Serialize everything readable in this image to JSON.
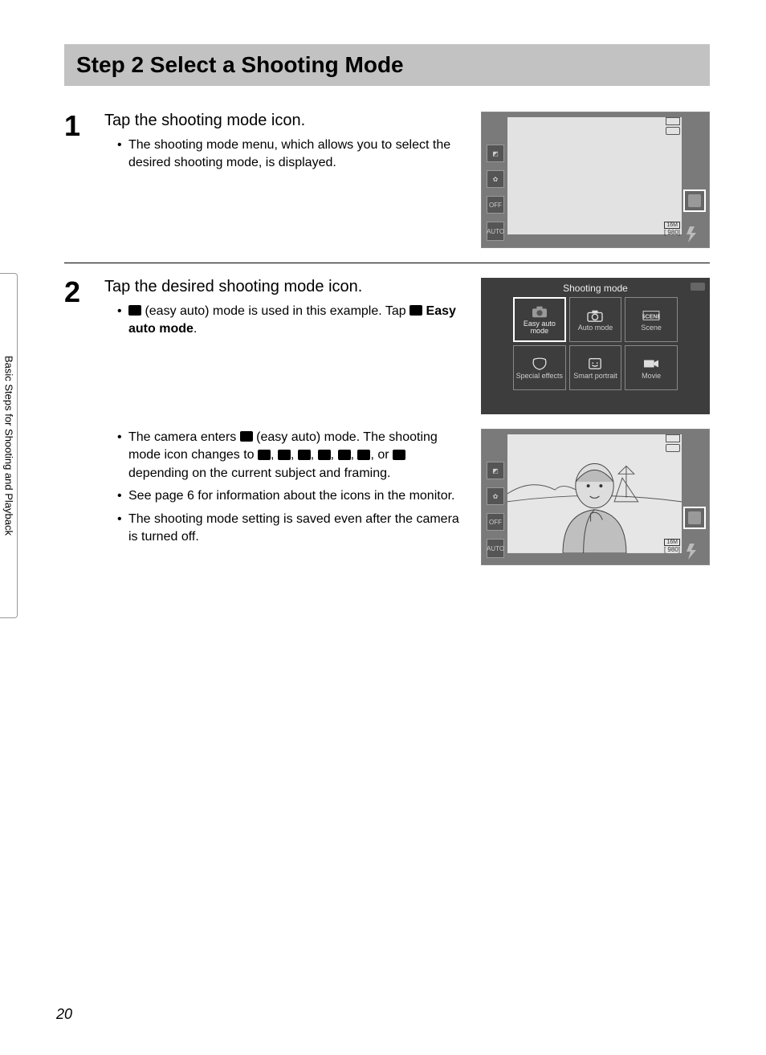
{
  "header": {
    "title": "Step 2 Select a Shooting Mode"
  },
  "side_tab": "Basic Steps for Shooting and Playback",
  "page_number": "20",
  "step1": {
    "num": "1",
    "title": "Tap the shooting mode icon.",
    "bullets": [
      "The shooting mode menu, which allows you to select the desired shooting mode, is displayed."
    ],
    "lcd": {
      "side_icons": [
        "◩",
        "✿",
        "OFF",
        "AUTO"
      ],
      "resolution": "16M",
      "counter": "[  980]"
    }
  },
  "step2": {
    "num": "2",
    "title": "Tap the desired shooting mode icon.",
    "bullet_a_pre": " (easy auto) mode is used in this example. Tap ",
    "bullet_a_bold": " Easy auto mode",
    "bullet_a_post": ".",
    "menu": {
      "title": "Shooting mode",
      "cells": [
        {
          "label": "Easy auto mode",
          "icon": "camera-heart",
          "selected": true
        },
        {
          "label": "Auto mode",
          "icon": "camera"
        },
        {
          "label": "Scene",
          "icon": "scene"
        },
        {
          "label": "Special effects",
          "icon": "effects"
        },
        {
          "label": "Smart portrait",
          "icon": "smile"
        },
        {
          "label": "Movie",
          "icon": "movie"
        }
      ]
    },
    "bullet_b_pre": "The camera enters ",
    "bullet_b_mid": " (easy auto) mode. The shooting mode icon changes to ",
    "bullet_b_post": " depending on the current subject and framing.",
    "bullet_b_sep1": ", ",
    "bullet_b_sep_or": ", or ",
    "bullet_c": "See page 6 for information about the icons in the monitor.",
    "bullet_d": "The shooting mode setting is saved even after the camera is turned off.",
    "lcd2": {
      "side_icons": [
        "◩",
        "✿",
        "OFF",
        "AUTO"
      ],
      "resolution": "16M",
      "counter": "[  980]"
    }
  }
}
